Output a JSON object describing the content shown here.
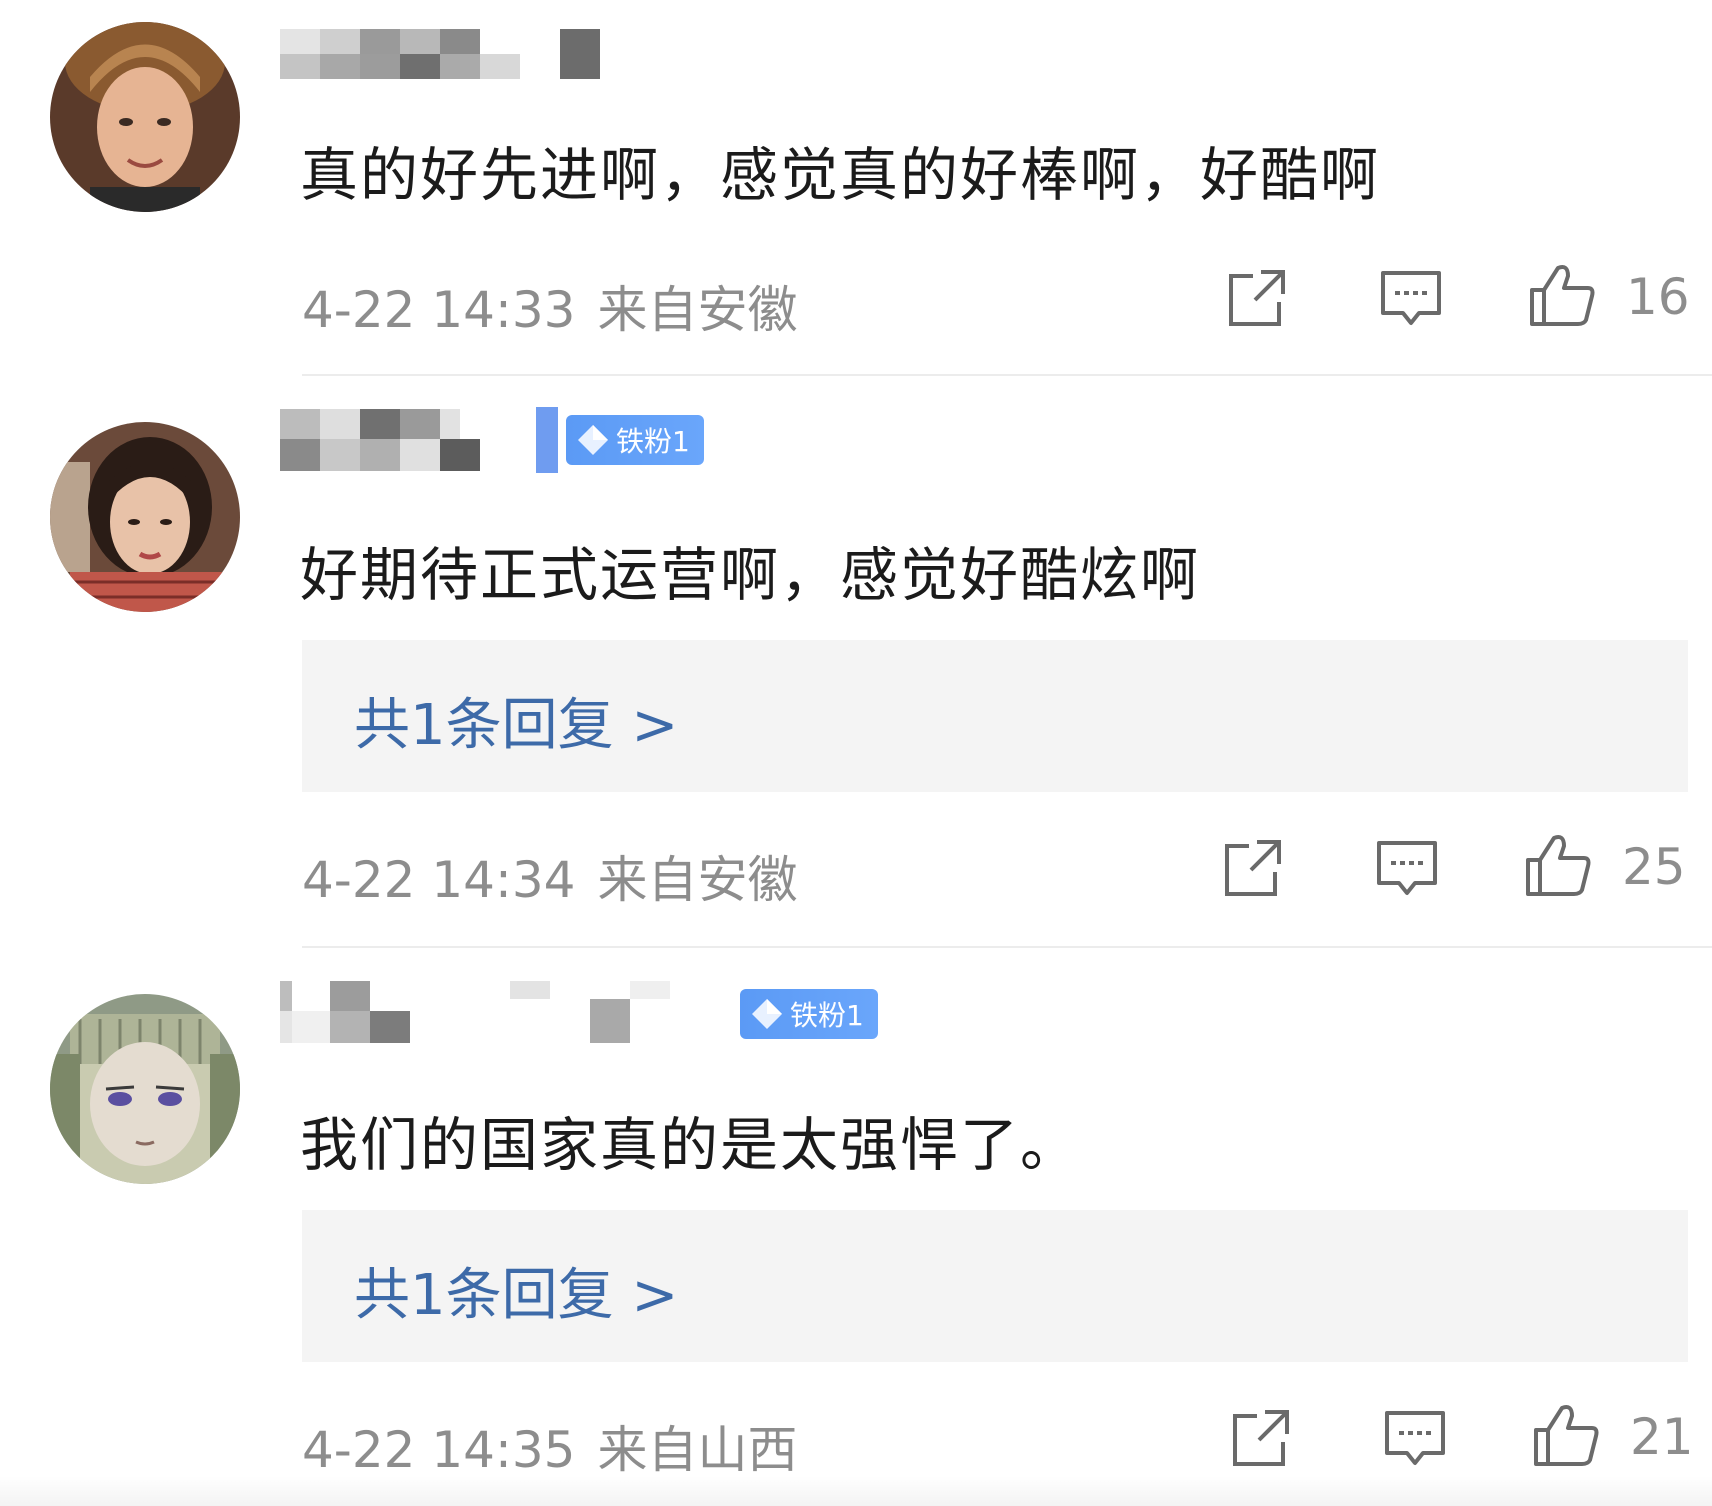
{
  "comments": [
    {
      "text": "真的好先进啊，感觉真的好棒啊，好酷啊",
      "badge": "",
      "reply_link": "",
      "time": "4-22 14:33",
      "location": "来自安徽",
      "likes": "16",
      "avatar_icon": "user-avatar"
    },
    {
      "text": "好期待正式运营啊，感觉好酷炫啊",
      "badge": "铁粉1",
      "reply_link": "共1条回复 >",
      "time": "4-22 14:34",
      "location": "来自安徽",
      "likes": "25",
      "avatar_icon": "user-avatar"
    },
    {
      "text": "我们的国家真的是太强悍了。",
      "badge": "铁粉1",
      "reply_link": "共1条回复 >",
      "time": "4-22 14:35",
      "location": "来自山西",
      "likes": "21",
      "avatar_icon": "user-avatar"
    }
  ],
  "icons": {
    "share": "share-icon",
    "reply": "comment-icon",
    "like": "thumbs-up-icon",
    "badge": "diamond-icon"
  },
  "colors": {
    "link": "#3d6aa8",
    "meta": "#8d8d8d",
    "badge": "#5b9af5",
    "reply_bg": "#f4f4f4"
  }
}
